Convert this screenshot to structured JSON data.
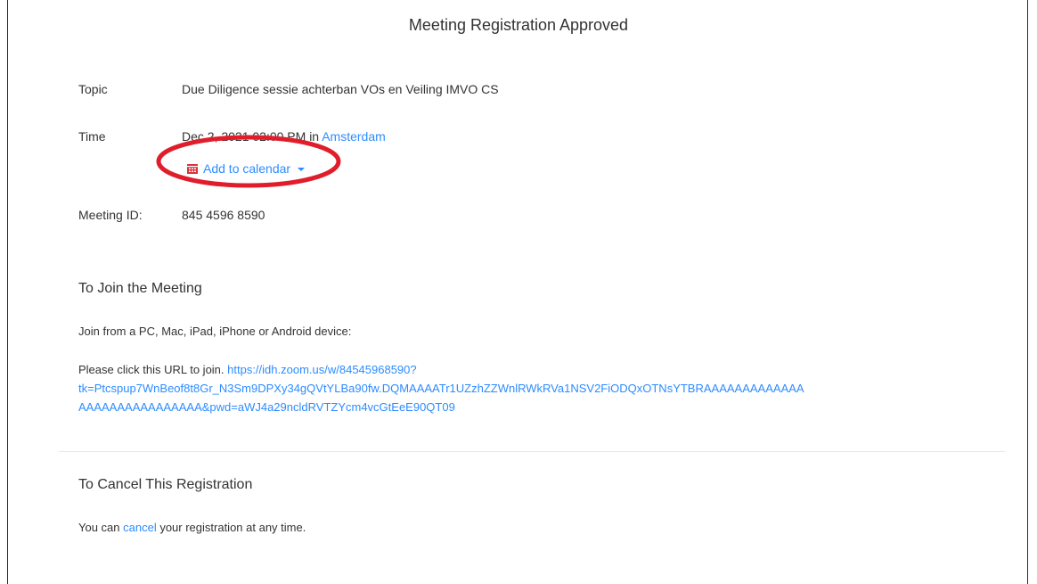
{
  "page_title": "Meeting Registration Approved",
  "details": {
    "topic_label": "Topic",
    "topic_value": "Due Diligence sessie achterban VOs en Veiling IMVO CS",
    "time_label": "Time",
    "time_value_prefix": "Dec 2, 2021 02:00 PM in ",
    "time_zone_link": "Amsterdam",
    "add_to_calendar": "Add to calendar",
    "meeting_id_label": "Meeting ID:",
    "meeting_id_value": "845 4596 8590"
  },
  "join": {
    "title": "To Join the Meeting",
    "devices_text": "Join from a PC, Mac, iPad, iPhone or Android device:",
    "url_prefix": "Please click this URL to join. ",
    "url_line1": "https://idh.zoom.us/w/84545968590?",
    "url_line2": "tk=Ptcspup7WnBeof8t8Gr_N3Sm9DPXy34gQVtYLBa90fw.DQMAAAATr1UZzhZZWnlRWkRVa1NSV2FiODQxOTNsYTBRAAAAAAAAAAAAA",
    "url_line3": "AAAAAAAAAAAAAAAA&pwd=aWJ4a29ncldRVTZYcm4vcGtEeE90QT09"
  },
  "cancel": {
    "title": "To Cancel This Registration",
    "text_prefix": "You can ",
    "link": "cancel",
    "text_suffix": " your registration at any time."
  },
  "colors": {
    "link": "#2d8cff",
    "annotation": "#e01e2b",
    "calendar_icon": "#d9333f"
  }
}
